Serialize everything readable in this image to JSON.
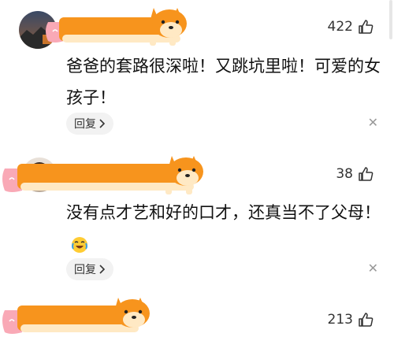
{
  "comments": [
    {
      "likes": "422",
      "text": "爸爸的套路很深啦！又跳坑里啦！可爱的女孩子！",
      "reply": "回复"
    },
    {
      "likes": "38",
      "text": "没有点才艺和好的口才，还真当不了父母！",
      "emoji": "laughing-crying-emoji",
      "reply": "回复"
    },
    {
      "likes": "213"
    }
  ],
  "icons": {
    "like": "thumbs-up-icon",
    "reply_chevron": "chevron-right-icon",
    "dismiss": "close-icon"
  },
  "colors": {
    "dog_orange": "#F7941D",
    "dog_belly": "#FFE9C4",
    "dog_butt": "#F9A9B6"
  }
}
